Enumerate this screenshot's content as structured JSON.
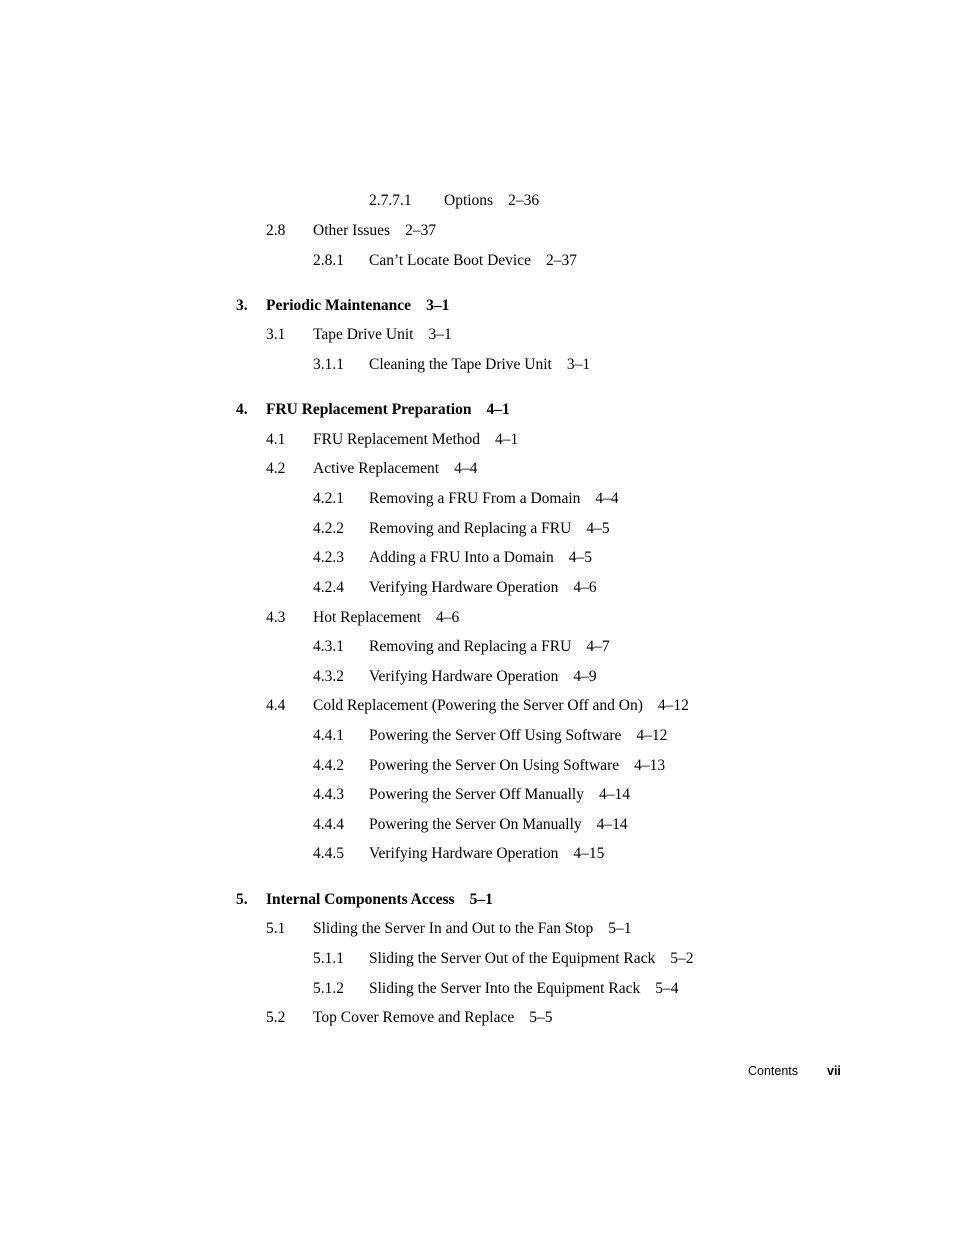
{
  "toc": [
    {
      "num": "2.7.7.1",
      "title": "Options",
      "page": "2–36",
      "level": 3
    },
    {
      "num": "2.8",
      "title": "Other Issues",
      "page": "2–37",
      "level": 1
    },
    {
      "num": "2.8.1",
      "title": "Can’t Locate Boot Device",
      "page": "2–37",
      "level": 2
    },
    {
      "num": "3.",
      "title": "Periodic Maintenance",
      "page": "3–1",
      "level": 0
    },
    {
      "num": "3.1",
      "title": "Tape Drive Unit",
      "page": "3–1",
      "level": 1
    },
    {
      "num": "3.1.1",
      "title": "Cleaning the Tape Drive Unit",
      "page": "3–1",
      "level": 2
    },
    {
      "num": "4.",
      "title": "FRU Replacement Preparation",
      "page": "4–1",
      "level": 0
    },
    {
      "num": "4.1",
      "title": "FRU Replacement Method",
      "page": "4–1",
      "level": 1
    },
    {
      "num": "4.2",
      "title": "Active Replacement",
      "page": "4–4",
      "level": 1
    },
    {
      "num": "4.2.1",
      "title": "Removing a FRU From a Domain",
      "page": "4–4",
      "level": 2
    },
    {
      "num": "4.2.2",
      "title": "Removing and Replacing a FRU",
      "page": "4–5",
      "level": 2
    },
    {
      "num": "4.2.3",
      "title": "Adding a FRU Into a Domain",
      "page": "4–5",
      "level": 2
    },
    {
      "num": "4.2.4",
      "title": "Verifying Hardware Operation",
      "page": "4–6",
      "level": 2
    },
    {
      "num": "4.3",
      "title": "Hot Replacement",
      "page": "4–6",
      "level": 1
    },
    {
      "num": "4.3.1",
      "title": "Removing and Replacing a FRU",
      "page": "4–7",
      "level": 2
    },
    {
      "num": "4.3.2",
      "title": "Verifying Hardware Operation",
      "page": "4–9",
      "level": 2
    },
    {
      "num": "4.4",
      "title": "Cold Replacement (Powering the Server Off and On)",
      "page": "4–12",
      "level": 1
    },
    {
      "num": "4.4.1",
      "title": "Powering the Server Off Using Software",
      "page": "4–12",
      "level": 2
    },
    {
      "num": "4.4.2",
      "title": "Powering the Server On Using Software",
      "page": "4–13",
      "level": 2
    },
    {
      "num": "4.4.3",
      "title": "Powering the Server Off Manually",
      "page": "4–14",
      "level": 2
    },
    {
      "num": "4.4.4",
      "title": "Powering the Server On Manually",
      "page": "4–14",
      "level": 2
    },
    {
      "num": "4.4.5",
      "title": "Verifying Hardware Operation",
      "page": "4–15",
      "level": 2
    },
    {
      "num": "5.",
      "title": "Internal Components Access",
      "page": "5–1",
      "level": 0
    },
    {
      "num": "5.1",
      "title": "Sliding the Server In and Out to the Fan Stop",
      "page": "5–1",
      "level": 1
    },
    {
      "num": "5.1.1",
      "title": "Sliding the Server Out of the Equipment Rack",
      "page": "5–2",
      "level": 2
    },
    {
      "num": "5.1.2",
      "title": "Sliding the Server Into the Equipment Rack",
      "page": "5–4",
      "level": 2
    },
    {
      "num": "5.2",
      "title": "Top Cover Remove and Replace",
      "page": "5–5",
      "level": 1
    }
  ],
  "footer": {
    "label": "Contents",
    "page": "vii"
  }
}
